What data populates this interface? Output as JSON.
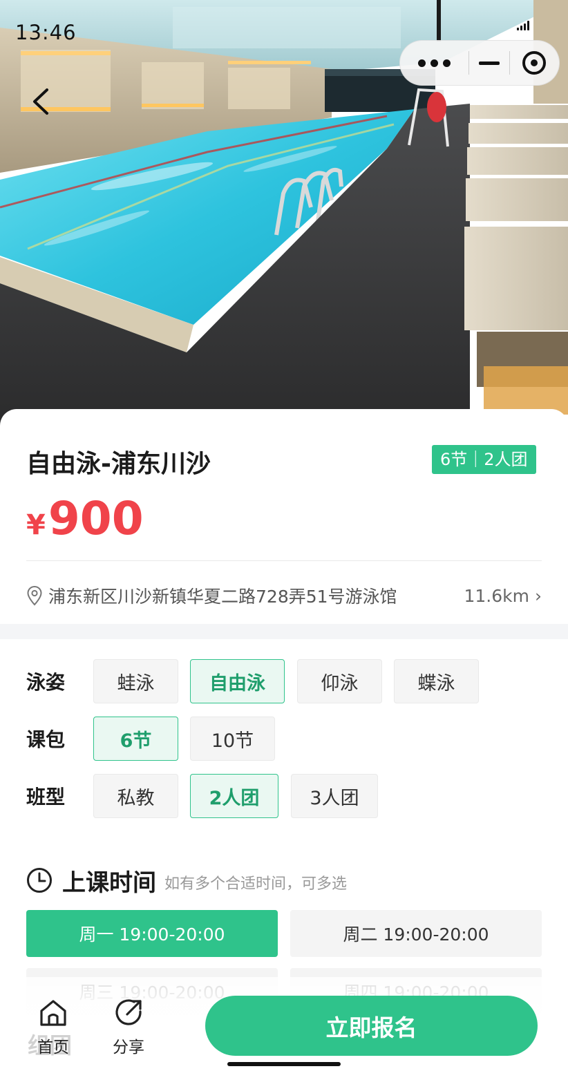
{
  "status_bar": {
    "time": "13:46"
  },
  "hero": {
    "photo_subject": "indoor swimming pool"
  },
  "course": {
    "title": "自由泳-浦东川沙",
    "badge": "6节｜2人团",
    "price_currency": "¥",
    "price_value": "900"
  },
  "location": {
    "address": "浦东新区川沙新镇华夏二路728弄51号游泳馆",
    "distance": "11.6km",
    "arrow": "›"
  },
  "options": {
    "stroke": {
      "label": "泳姿",
      "items": [
        "蛙泳",
        "自由泳",
        "仰泳",
        "蝶泳"
      ],
      "selected": "自由泳"
    },
    "package": {
      "label": "课包",
      "items": [
        "6节",
        "10节"
      ],
      "selected": "6节"
    },
    "class_type": {
      "label": "班型",
      "items": [
        "私教",
        "2人团",
        "3人团"
      ],
      "selected": "2人团"
    }
  },
  "schedule": {
    "title": "上课时间",
    "hint": "如有多个合适时间，可多选",
    "slots": [
      "周一 19:00-20:00",
      "周二 19:00-20:00",
      "周三 19:00-20:00",
      "周四 19:00-20:00"
    ],
    "selected": "周一 19:00-20:00"
  },
  "partial_section": {
    "title_fragment": "组团"
  },
  "bottom_bar": {
    "home_label": "首页",
    "share_label": "分享",
    "cta_label": "立即报名"
  },
  "colors": {
    "accent": "#2fc38b",
    "price": "#f0434a",
    "active_chip_bg": "#eaf8f2"
  },
  "icons": [
    "back-icon",
    "more-dots-icon",
    "minimize-icon",
    "close-target-icon",
    "location-pin-icon",
    "clock-icon",
    "home-icon",
    "share-icon"
  ]
}
